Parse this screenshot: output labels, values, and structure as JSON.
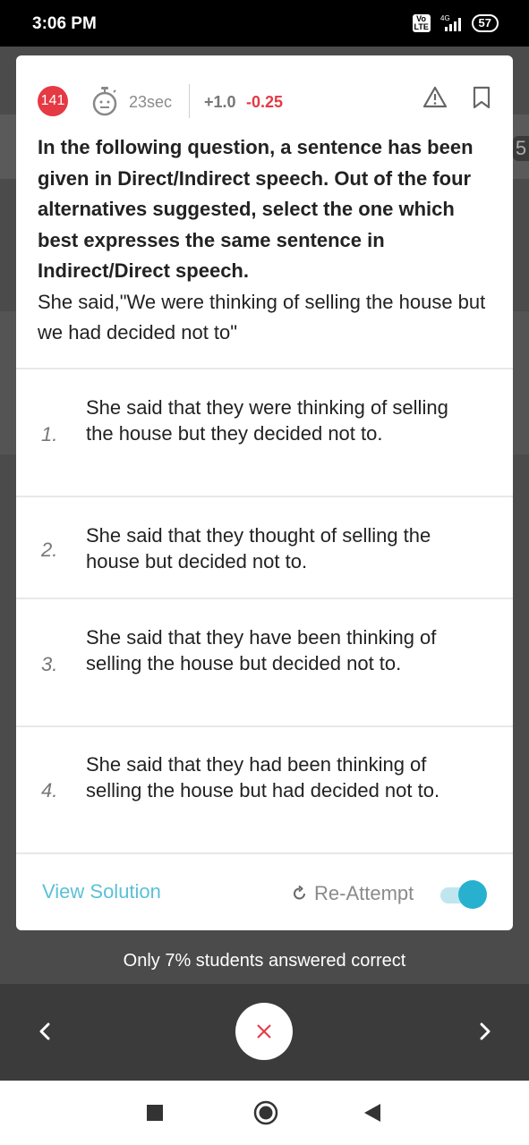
{
  "status_bar": {
    "time": "3:06 PM",
    "volte": "Vo LTE",
    "network": "4G",
    "battery": "57"
  },
  "question_header": {
    "number": "141",
    "timer": "23sec",
    "positive_marks": "+1.0",
    "negative_marks": "-0.25"
  },
  "question": {
    "instruction": "In the following question, a sentence has been given in Direct/Indirect speech. Out of the four alternatives suggested, select the one which best expresses the same sentence in Indirect/Direct speech.",
    "sentence": "She said,\"We were thinking of selling the house but we had decided not to\""
  },
  "options": [
    {
      "number": "1.",
      "text": "She said that they were thinking of selling the house but they decided not to."
    },
    {
      "number": "2.",
      "text": "She said that they thought of selling the house but decided not to."
    },
    {
      "number": "3.",
      "text": "She said that they have been thinking of selling the house but decided not to."
    },
    {
      "number": "4.",
      "text": "She said that they had been thinking of selling the house but had decided not to."
    }
  ],
  "actions": {
    "view_solution": "View Solution",
    "reattempt": "Re-Attempt",
    "reattempt_toggle_on": true
  },
  "footer": {
    "stats": "Only 7% students answered correct"
  },
  "background": {
    "peek_number": "5"
  },
  "colors": {
    "accent": "#27b1cf",
    "link": "#5cc0d6",
    "danger": "#e53944"
  }
}
